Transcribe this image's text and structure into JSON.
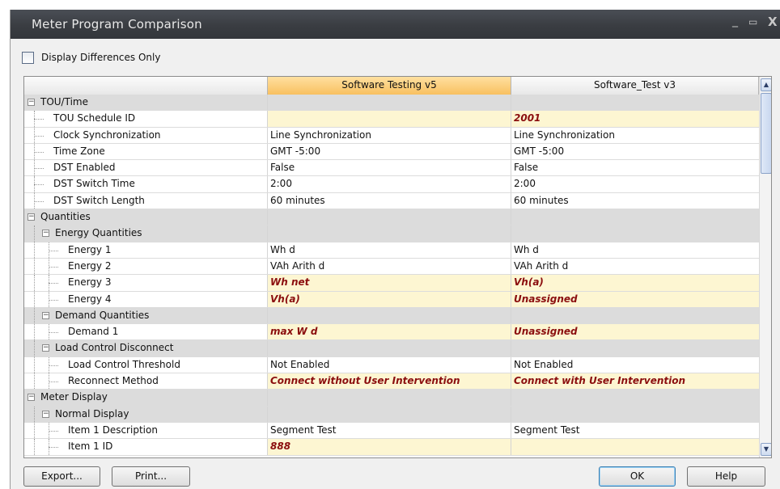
{
  "window": {
    "title": "Meter Program Comparison",
    "controls": {
      "minimize": "_",
      "maximize": "▭",
      "close": "X"
    }
  },
  "options": {
    "display_differences_only_label": "Display Differences Only",
    "display_differences_only_checked": false
  },
  "grid": {
    "columns": [
      "",
      "Software Testing v5",
      "Software_Test v3"
    ],
    "rows": [
      {
        "label": "TOU/Time",
        "level": 0,
        "group": true,
        "v1": "",
        "v2": ""
      },
      {
        "label": "TOU Schedule ID",
        "level": 1,
        "diff": true,
        "v1": "",
        "v2": "2001"
      },
      {
        "label": "Clock Synchronization",
        "level": 1,
        "v1": "Line Synchronization",
        "v2": "Line Synchronization"
      },
      {
        "label": "Time Zone",
        "level": 1,
        "v1": "GMT -5:00",
        "v2": "GMT -5:00"
      },
      {
        "label": "DST Enabled",
        "level": 1,
        "v1": "False",
        "v2": "False"
      },
      {
        "label": "DST Switch Time",
        "level": 1,
        "v1": "2:00",
        "v2": "2:00"
      },
      {
        "label": "DST Switch Length",
        "level": 1,
        "v1": "60 minutes",
        "v2": "60 minutes"
      },
      {
        "label": "Quantities",
        "level": 0,
        "group": true,
        "v1": "",
        "v2": ""
      },
      {
        "label": "Energy Quantities",
        "level": 1,
        "group": true,
        "v1": "",
        "v2": ""
      },
      {
        "label": "Energy 1",
        "level": 2,
        "v1": "Wh d",
        "v2": "Wh d"
      },
      {
        "label": "Energy 2",
        "level": 2,
        "v1": "VAh Arith d",
        "v2": "VAh Arith d"
      },
      {
        "label": "Energy 3",
        "level": 2,
        "diff": true,
        "v1": "Wh net",
        "v2": "Vh(a)"
      },
      {
        "label": "Energy 4",
        "level": 2,
        "diff": true,
        "v1": "Vh(a)",
        "v2": "Unassigned"
      },
      {
        "label": "Demand Quantities",
        "level": 1,
        "group": true,
        "v1": "",
        "v2": ""
      },
      {
        "label": "Demand 1",
        "level": 2,
        "diff": true,
        "v1": "max W d",
        "v2": "Unassigned"
      },
      {
        "label": "Load Control Disconnect",
        "level": 1,
        "group": true,
        "v1": "",
        "v2": ""
      },
      {
        "label": "Load Control Threshold",
        "level": 2,
        "v1": "Not Enabled",
        "v2": "Not Enabled"
      },
      {
        "label": "Reconnect Method",
        "level": 2,
        "diff": true,
        "v1": "Connect without User Intervention",
        "v2": "Connect with User Intervention"
      },
      {
        "label": "Meter Display",
        "level": 0,
        "group": true,
        "v1": "",
        "v2": ""
      },
      {
        "label": "Normal Display",
        "level": 1,
        "group": true,
        "v1": "",
        "v2": ""
      },
      {
        "label": "Item 1 Description",
        "level": 2,
        "v1": "Segment Test",
        "v2": "Segment Test"
      },
      {
        "label": "Item 1 ID",
        "level": 2,
        "diff": true,
        "v1": "888",
        "v2": ""
      }
    ]
  },
  "buttons": {
    "export": "Export...",
    "print": "Print...",
    "ok": "OK",
    "help": "Help"
  },
  "scrollbar": {
    "up": "▲",
    "down": "▼"
  }
}
